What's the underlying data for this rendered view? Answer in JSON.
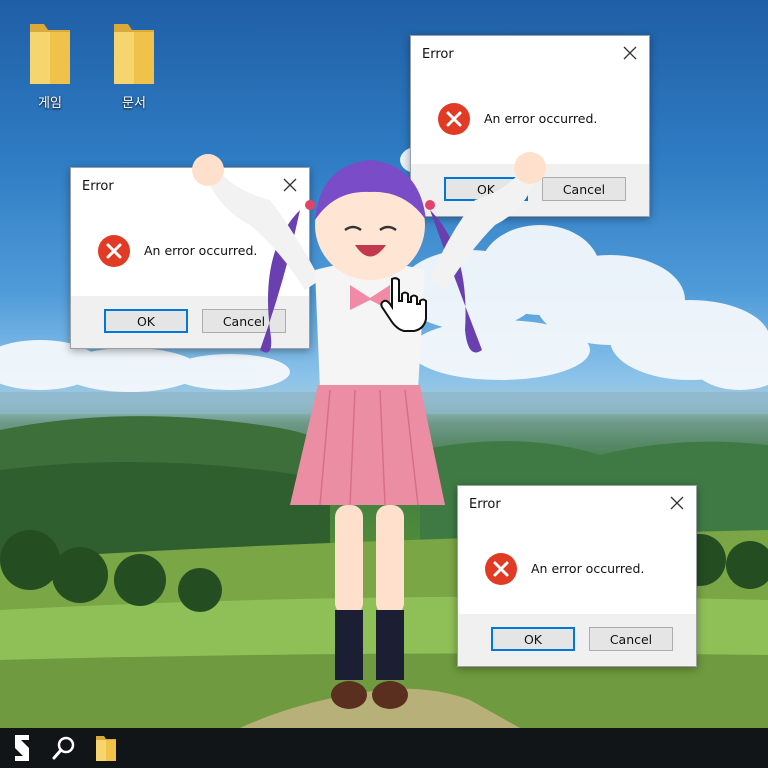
{
  "desktop": {
    "icons": [
      {
        "label": "게임",
        "icon": "folder-icon"
      },
      {
        "label": "문서",
        "icon": "folder-icon"
      }
    ]
  },
  "dialogs": [
    {
      "title": "Error",
      "message": "An error occurred.",
      "ok_label": "OK",
      "cancel_label": "Cancel",
      "icon": "error-icon",
      "close_icon": "close-icon"
    },
    {
      "title": "Error",
      "message": "An error occurred.",
      "ok_label": "OK",
      "cancel_label": "Cancel",
      "icon": "error-icon",
      "close_icon": "close-icon"
    },
    {
      "title": "Error",
      "message": "An error occurred.",
      "ok_label": "OK",
      "cancel_label": "Cancel",
      "icon": "error-icon",
      "close_icon": "close-icon"
    }
  ],
  "taskbar": {
    "items": [
      {
        "icon": "start-logo-icon"
      },
      {
        "icon": "search-icon"
      },
      {
        "icon": "folder-icon"
      }
    ]
  },
  "colors": {
    "accent": "#0078d7",
    "error_red": "#e23b25",
    "taskbar": "#111518",
    "folder_yellow": "#f0c24a"
  }
}
